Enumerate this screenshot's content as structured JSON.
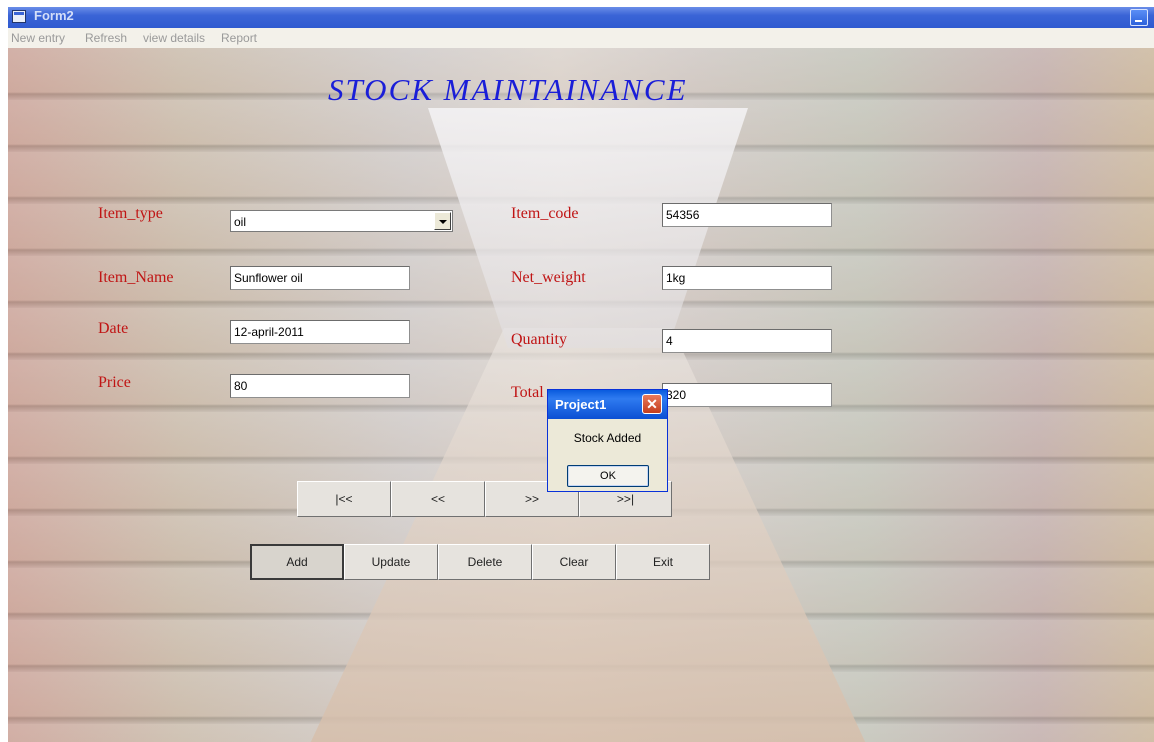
{
  "window": {
    "title": "Form2"
  },
  "menu": [
    "New entry",
    "Refresh",
    "view details",
    "Report"
  ],
  "form": {
    "heading": "STOCK MAINTAINANCE",
    "labels": {
      "item_type": "Item_type",
      "item_name": "Item_Name",
      "date": "Date",
      "price": "Price",
      "item_code": "Item_code",
      "net_weight": "Net_weight",
      "quantity": "Quantity",
      "total": "Total"
    },
    "values": {
      "item_type": "oil",
      "item_name": "Sunflower oil",
      "date": "12-april-2011",
      "price": "80",
      "item_code": "54356",
      "net_weight": "1kg",
      "quantity": "4",
      "total": "320"
    }
  },
  "nav_buttons": [
    "|<<",
    "<<",
    ">>",
    ">>|"
  ],
  "action_buttons": [
    "Add",
    "Update",
    "Delete",
    "Clear",
    "Exit"
  ],
  "dialog": {
    "title": "Project1",
    "message": "Stock Added",
    "ok_label": "OK"
  }
}
